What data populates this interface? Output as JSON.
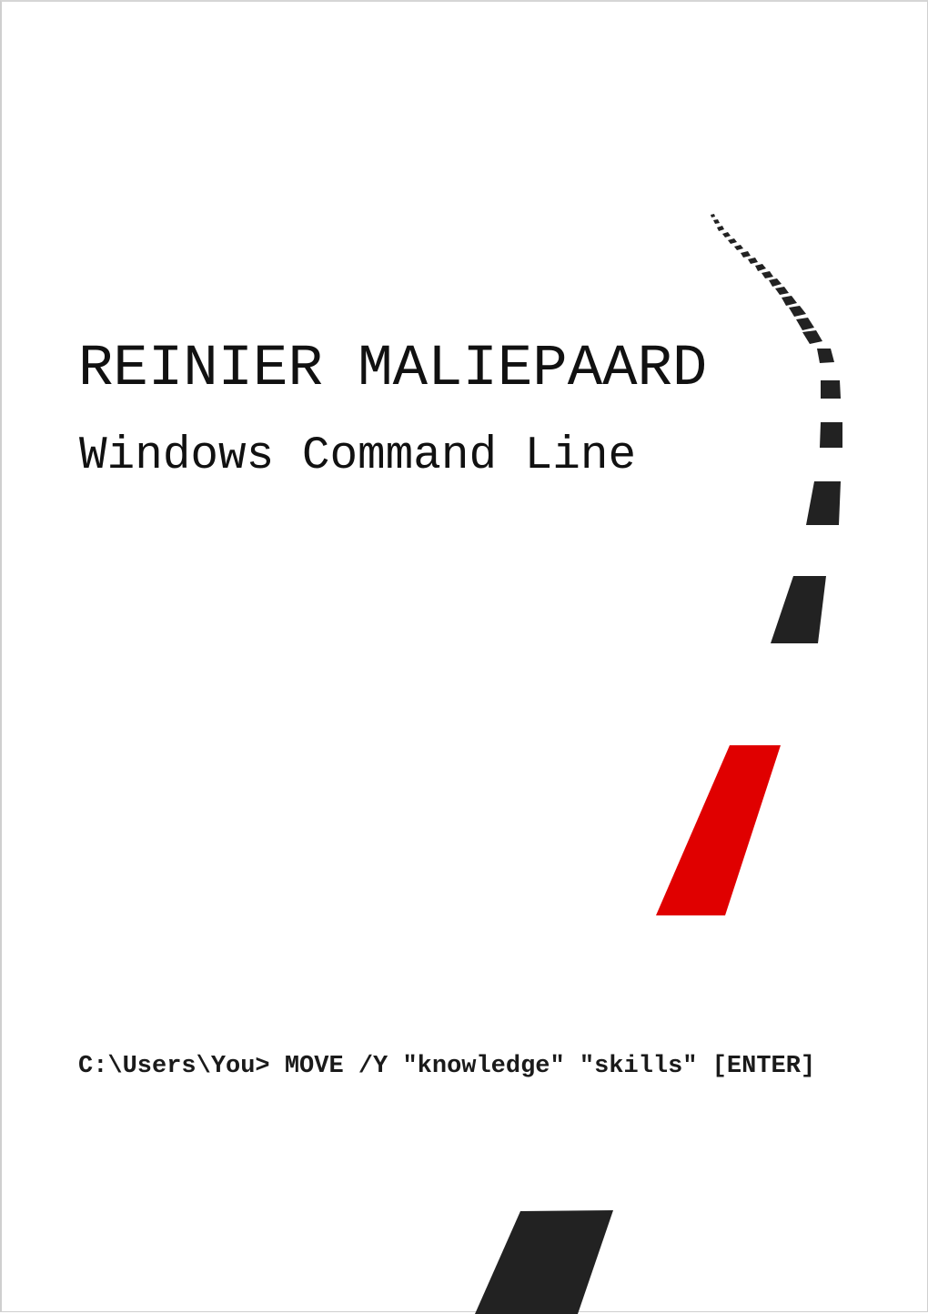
{
  "document": {
    "author": "REINIER MALIEPAARD",
    "title": "Windows Command Line",
    "command_line": "C:\\Users\\You> MOVE /Y \"knowledge\" \"skills\" [ENTER]"
  },
  "illustration": {
    "description": "road-center-line-dashes",
    "colors": {
      "dash": "#222222",
      "highlight_dash": "#e00000"
    }
  }
}
